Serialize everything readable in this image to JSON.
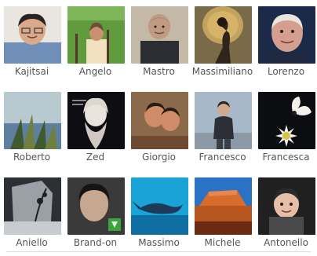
{
  "members": [
    {
      "name": "Kajitsai",
      "colors": {
        "bg": "#e9e6e2",
        "skin": "#d9a98c",
        "cloth": "#6f8fb8",
        "hair": "#2a2220"
      }
    },
    {
      "name": "Angelo",
      "colors": {
        "bg": "#5f9a3c",
        "skin": "#c89272",
        "cloth": "#f1e1bf",
        "hair": "#6b4e33"
      }
    },
    {
      "name": "Mastro",
      "colors": {
        "bg": "#c4b9a6",
        "skin": "#c09a82",
        "cloth": "#2b2d33",
        "hair": "#9b8b79"
      }
    },
    {
      "name": "Massimiliano",
      "colors": {
        "bg": "#7a6a48",
        "skin": "#c2a35c",
        "cloth": "#2f2518",
        "hair": "#1f1710"
      }
    },
    {
      "name": "Lorenzo",
      "colors": {
        "bg": "#1c2a4a",
        "skin": "#d49f8e",
        "cloth": "#1f2a42",
        "hair": "#eae4de"
      }
    },
    {
      "name": "Roberto",
      "colors": {
        "bg": "#b8c9cf",
        "skin": "#6f7f3f",
        "cloth": "#5f7fa0",
        "hair": "#3f5a2f"
      }
    },
    {
      "name": "Zed",
      "colors": {
        "bg": "#0d0d12",
        "skin": "#e9e3db",
        "cloth": "#cfc8c0",
        "hair": "#dcd6cf"
      }
    },
    {
      "name": "Giorgio",
      "colors": {
        "bg": "#8a6a4a",
        "skin": "#d08b6a",
        "cloth": "#6e4a32",
        "hair": "#2a1b12"
      }
    },
    {
      "name": "Francesco",
      "colors": {
        "bg": "#a7b8c9",
        "skin": "#d1aa8e",
        "cloth": "#2c3036",
        "hair": "#2a221d"
      }
    },
    {
      "name": "Francesca",
      "colors": {
        "bg": "#0c0d10",
        "skin": "#f3f1ea",
        "cloth": "#d4c64b",
        "hair": "#a08a2a"
      }
    },
    {
      "name": "Aniello",
      "colors": {
        "bg": "#2c2f33",
        "skin": "#c8ccd1",
        "cloth": "#9aa0a6",
        "hair": "#1e2022"
      }
    },
    {
      "name": "Brand-on",
      "colors": {
        "bg": "#3a3a3a",
        "skin": "#c7a88f",
        "cloth": "#2b2b2b",
        "hair": "#151515"
      }
    },
    {
      "name": "Massimo",
      "colors": {
        "bg": "#1aa3d6",
        "skin": "#1e3a5b",
        "cloth": "#0f6fa3",
        "hair": "#0b2a3b"
      }
    },
    {
      "name": "Michele",
      "colors": {
        "bg": "#2a73c4",
        "skin": "#d86c2c",
        "cloth": "#b8561f",
        "hair": "#6d2a12"
      }
    },
    {
      "name": "Antonello",
      "colors": {
        "bg": "#202020",
        "skin": "#e7bfa7",
        "cloth": "#4a4a4a",
        "hair": "#2b2b2b"
      }
    }
  ]
}
